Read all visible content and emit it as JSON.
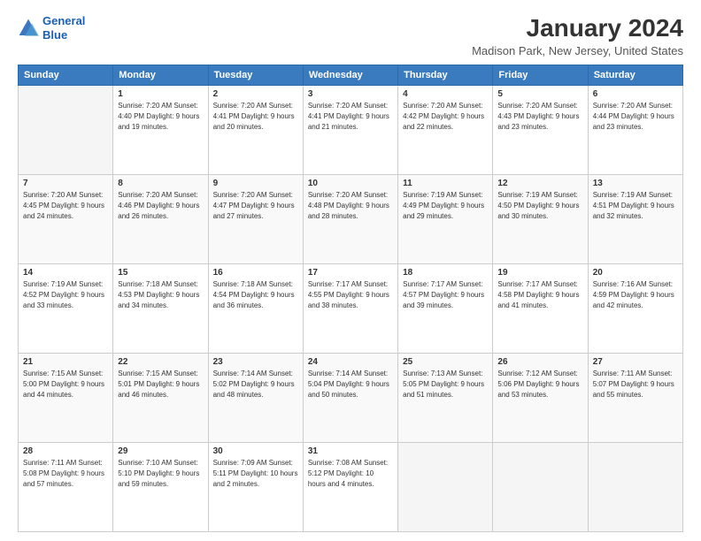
{
  "header": {
    "logo_line1": "General",
    "logo_line2": "Blue",
    "title": "January 2024",
    "subtitle": "Madison Park, New Jersey, United States"
  },
  "weekdays": [
    "Sunday",
    "Monday",
    "Tuesday",
    "Wednesday",
    "Thursday",
    "Friday",
    "Saturday"
  ],
  "weeks": [
    [
      {
        "day": "",
        "info": ""
      },
      {
        "day": "1",
        "info": "Sunrise: 7:20 AM\nSunset: 4:40 PM\nDaylight: 9 hours\nand 19 minutes."
      },
      {
        "day": "2",
        "info": "Sunrise: 7:20 AM\nSunset: 4:41 PM\nDaylight: 9 hours\nand 20 minutes."
      },
      {
        "day": "3",
        "info": "Sunrise: 7:20 AM\nSunset: 4:41 PM\nDaylight: 9 hours\nand 21 minutes."
      },
      {
        "day": "4",
        "info": "Sunrise: 7:20 AM\nSunset: 4:42 PM\nDaylight: 9 hours\nand 22 minutes."
      },
      {
        "day": "5",
        "info": "Sunrise: 7:20 AM\nSunset: 4:43 PM\nDaylight: 9 hours\nand 23 minutes."
      },
      {
        "day": "6",
        "info": "Sunrise: 7:20 AM\nSunset: 4:44 PM\nDaylight: 9 hours\nand 23 minutes."
      }
    ],
    [
      {
        "day": "7",
        "info": ""
      },
      {
        "day": "8",
        "info": "Sunrise: 7:20 AM\nSunset: 4:46 PM\nDaylight: 9 hours\nand 26 minutes."
      },
      {
        "day": "9",
        "info": "Sunrise: 7:20 AM\nSunset: 4:47 PM\nDaylight: 9 hours\nand 27 minutes."
      },
      {
        "day": "10",
        "info": "Sunrise: 7:20 AM\nSunset: 4:48 PM\nDaylight: 9 hours\nand 28 minutes."
      },
      {
        "day": "11",
        "info": "Sunrise: 7:19 AM\nSunset: 4:49 PM\nDaylight: 9 hours\nand 29 minutes."
      },
      {
        "day": "12",
        "info": "Sunrise: 7:19 AM\nSunset: 4:50 PM\nDaylight: 9 hours\nand 30 minutes."
      },
      {
        "day": "13",
        "info": "Sunrise: 7:19 AM\nSunset: 4:51 PM\nDaylight: 9 hours\nand 32 minutes."
      }
    ],
    [
      {
        "day": "14",
        "info": ""
      },
      {
        "day": "15",
        "info": "Sunrise: 7:18 AM\nSunset: 4:53 PM\nDaylight: 9 hours\nand 34 minutes."
      },
      {
        "day": "16",
        "info": "Sunrise: 7:18 AM\nSunset: 4:54 PM\nDaylight: 9 hours\nand 36 minutes."
      },
      {
        "day": "17",
        "info": "Sunrise: 7:17 AM\nSunset: 4:55 PM\nDaylight: 9 hours\nand 38 minutes."
      },
      {
        "day": "18",
        "info": "Sunrise: 7:17 AM\nSunset: 4:57 PM\nDaylight: 9 hours\nand 39 minutes."
      },
      {
        "day": "19",
        "info": "Sunrise: 7:17 AM\nSunset: 4:58 PM\nDaylight: 9 hours\nand 41 minutes."
      },
      {
        "day": "20",
        "info": "Sunrise: 7:16 AM\nSunset: 4:59 PM\nDaylight: 9 hours\nand 42 minutes."
      }
    ],
    [
      {
        "day": "21",
        "info": ""
      },
      {
        "day": "22",
        "info": "Sunrise: 7:15 AM\nSunset: 5:01 PM\nDaylight: 9 hours\nand 46 minutes."
      },
      {
        "day": "23",
        "info": "Sunrise: 7:14 AM\nSunset: 5:02 PM\nDaylight: 9 hours\nand 48 minutes."
      },
      {
        "day": "24",
        "info": "Sunrise: 7:14 AM\nSunset: 5:04 PM\nDaylight: 9 hours\nand 50 minutes."
      },
      {
        "day": "25",
        "info": "Sunrise: 7:13 AM\nSunset: 5:05 PM\nDaylight: 9 hours\nand 51 minutes."
      },
      {
        "day": "26",
        "info": "Sunrise: 7:12 AM\nSunset: 5:06 PM\nDaylight: 9 hours\nand 53 minutes."
      },
      {
        "day": "27",
        "info": "Sunrise: 7:11 AM\nSunset: 5:07 PM\nDaylight: 9 hours\nand 55 minutes."
      }
    ],
    [
      {
        "day": "28",
        "info": "Sunrise: 7:11 AM\nSunset: 5:08 PM\nDaylight: 9 hours\nand 57 minutes."
      },
      {
        "day": "29",
        "info": "Sunrise: 7:10 AM\nSunset: 5:10 PM\nDaylight: 9 hours\nand 59 minutes."
      },
      {
        "day": "30",
        "info": "Sunrise: 7:09 AM\nSunset: 5:11 PM\nDaylight: 10 hours\nand 2 minutes."
      },
      {
        "day": "31",
        "info": "Sunrise: 7:08 AM\nSunset: 5:12 PM\nDaylight: 10 hours\nand 4 minutes."
      },
      {
        "day": "",
        "info": ""
      },
      {
        "day": "",
        "info": ""
      },
      {
        "day": "",
        "info": ""
      }
    ]
  ],
  "week1_day7_info": "Sunrise: 7:20 AM\nSunset: 4:45 PM\nDaylight: 9 hours\nand 24 minutes.",
  "week3_day14_info": "Sunrise: 7:19 AM\nSunset: 4:52 PM\nDaylight: 9 hours\nand 33 minutes.",
  "week4_day21_info": "Sunrise: 7:15 AM\nSunset: 5:00 PM\nDaylight: 9 hours\nand 44 minutes."
}
